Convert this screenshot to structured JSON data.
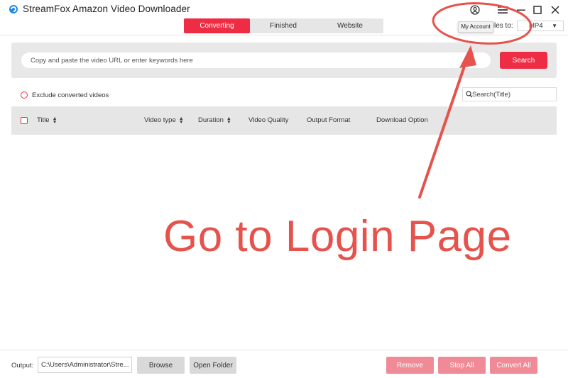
{
  "app": {
    "title": "StreamFox Amazon Video Downloader",
    "logo_icon": "app-logo-icon",
    "accent_color": "#ee2d44"
  },
  "tabs": [
    {
      "label": "Converting",
      "active": true
    },
    {
      "label": "Finished",
      "active": false
    },
    {
      "label": "Website",
      "active": false
    }
  ],
  "window_controls": {
    "account_icon": "user-circle-icon",
    "menu_icon": "hamburger-menu-icon",
    "minimize_icon": "minimize-icon",
    "maximize_icon": "maximize-icon",
    "close_icon": "close-icon"
  },
  "tooltip": {
    "text": "My Account"
  },
  "convert": {
    "label": "files to:",
    "format": "MP4"
  },
  "search": {
    "placeholder": "Copy and paste the video URL or enter keywords here",
    "button_label": "Search"
  },
  "filter": {
    "exclude_label": "Exclude converted videos",
    "title_search_placeholder": "Search(Title)"
  },
  "table": {
    "columns": [
      {
        "label": "Title",
        "sortable": true
      },
      {
        "label": "Video type",
        "sortable": true
      },
      {
        "label": "Duration",
        "sortable": true
      },
      {
        "label": "Video Quality",
        "sortable": false
      },
      {
        "label": "Output Format",
        "sortable": false
      },
      {
        "label": "Download Option",
        "sortable": false
      }
    ],
    "rows": []
  },
  "annotation": {
    "text": "Go to Login Page",
    "color": "#e5534c"
  },
  "footer": {
    "output_label": "Output:",
    "output_path": "C:\\Users\\Administrator\\Stre...",
    "browse_label": "Browse",
    "open_folder_label": "Open Folder",
    "remove_label": "Remove",
    "stop_all_label": "Stop All",
    "convert_all_label": "Convert All"
  }
}
